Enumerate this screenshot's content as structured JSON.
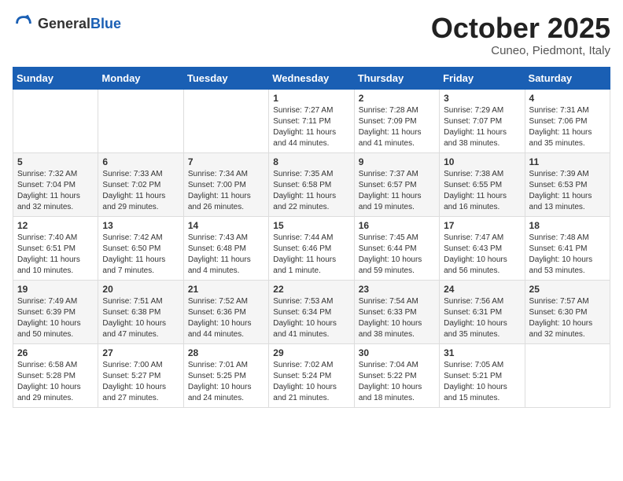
{
  "logo": {
    "general": "General",
    "blue": "Blue"
  },
  "title": {
    "month": "October 2025",
    "location": "Cuneo, Piedmont, Italy"
  },
  "weekdays": [
    "Sunday",
    "Monday",
    "Tuesday",
    "Wednesday",
    "Thursday",
    "Friday",
    "Saturday"
  ],
  "weeks": [
    [
      {
        "day": "",
        "info": ""
      },
      {
        "day": "",
        "info": ""
      },
      {
        "day": "",
        "info": ""
      },
      {
        "day": "1",
        "info": "Sunrise: 7:27 AM\nSunset: 7:11 PM\nDaylight: 11 hours\nand 44 minutes."
      },
      {
        "day": "2",
        "info": "Sunrise: 7:28 AM\nSunset: 7:09 PM\nDaylight: 11 hours\nand 41 minutes."
      },
      {
        "day": "3",
        "info": "Sunrise: 7:29 AM\nSunset: 7:07 PM\nDaylight: 11 hours\nand 38 minutes."
      },
      {
        "day": "4",
        "info": "Sunrise: 7:31 AM\nSunset: 7:06 PM\nDaylight: 11 hours\nand 35 minutes."
      }
    ],
    [
      {
        "day": "5",
        "info": "Sunrise: 7:32 AM\nSunset: 7:04 PM\nDaylight: 11 hours\nand 32 minutes."
      },
      {
        "day": "6",
        "info": "Sunrise: 7:33 AM\nSunset: 7:02 PM\nDaylight: 11 hours\nand 29 minutes."
      },
      {
        "day": "7",
        "info": "Sunrise: 7:34 AM\nSunset: 7:00 PM\nDaylight: 11 hours\nand 26 minutes."
      },
      {
        "day": "8",
        "info": "Sunrise: 7:35 AM\nSunset: 6:58 PM\nDaylight: 11 hours\nand 22 minutes."
      },
      {
        "day": "9",
        "info": "Sunrise: 7:37 AM\nSunset: 6:57 PM\nDaylight: 11 hours\nand 19 minutes."
      },
      {
        "day": "10",
        "info": "Sunrise: 7:38 AM\nSunset: 6:55 PM\nDaylight: 11 hours\nand 16 minutes."
      },
      {
        "day": "11",
        "info": "Sunrise: 7:39 AM\nSunset: 6:53 PM\nDaylight: 11 hours\nand 13 minutes."
      }
    ],
    [
      {
        "day": "12",
        "info": "Sunrise: 7:40 AM\nSunset: 6:51 PM\nDaylight: 11 hours\nand 10 minutes."
      },
      {
        "day": "13",
        "info": "Sunrise: 7:42 AM\nSunset: 6:50 PM\nDaylight: 11 hours\nand 7 minutes."
      },
      {
        "day": "14",
        "info": "Sunrise: 7:43 AM\nSunset: 6:48 PM\nDaylight: 11 hours\nand 4 minutes."
      },
      {
        "day": "15",
        "info": "Sunrise: 7:44 AM\nSunset: 6:46 PM\nDaylight: 11 hours\nand 1 minute."
      },
      {
        "day": "16",
        "info": "Sunrise: 7:45 AM\nSunset: 6:44 PM\nDaylight: 10 hours\nand 59 minutes."
      },
      {
        "day": "17",
        "info": "Sunrise: 7:47 AM\nSunset: 6:43 PM\nDaylight: 10 hours\nand 56 minutes."
      },
      {
        "day": "18",
        "info": "Sunrise: 7:48 AM\nSunset: 6:41 PM\nDaylight: 10 hours\nand 53 minutes."
      }
    ],
    [
      {
        "day": "19",
        "info": "Sunrise: 7:49 AM\nSunset: 6:39 PM\nDaylight: 10 hours\nand 50 minutes."
      },
      {
        "day": "20",
        "info": "Sunrise: 7:51 AM\nSunset: 6:38 PM\nDaylight: 10 hours\nand 47 minutes."
      },
      {
        "day": "21",
        "info": "Sunrise: 7:52 AM\nSunset: 6:36 PM\nDaylight: 10 hours\nand 44 minutes."
      },
      {
        "day": "22",
        "info": "Sunrise: 7:53 AM\nSunset: 6:34 PM\nDaylight: 10 hours\nand 41 minutes."
      },
      {
        "day": "23",
        "info": "Sunrise: 7:54 AM\nSunset: 6:33 PM\nDaylight: 10 hours\nand 38 minutes."
      },
      {
        "day": "24",
        "info": "Sunrise: 7:56 AM\nSunset: 6:31 PM\nDaylight: 10 hours\nand 35 minutes."
      },
      {
        "day": "25",
        "info": "Sunrise: 7:57 AM\nSunset: 6:30 PM\nDaylight: 10 hours\nand 32 minutes."
      }
    ],
    [
      {
        "day": "26",
        "info": "Sunrise: 6:58 AM\nSunset: 5:28 PM\nDaylight: 10 hours\nand 29 minutes."
      },
      {
        "day": "27",
        "info": "Sunrise: 7:00 AM\nSunset: 5:27 PM\nDaylight: 10 hours\nand 27 minutes."
      },
      {
        "day": "28",
        "info": "Sunrise: 7:01 AM\nSunset: 5:25 PM\nDaylight: 10 hours\nand 24 minutes."
      },
      {
        "day": "29",
        "info": "Sunrise: 7:02 AM\nSunset: 5:24 PM\nDaylight: 10 hours\nand 21 minutes."
      },
      {
        "day": "30",
        "info": "Sunrise: 7:04 AM\nSunset: 5:22 PM\nDaylight: 10 hours\nand 18 minutes."
      },
      {
        "day": "31",
        "info": "Sunrise: 7:05 AM\nSunset: 5:21 PM\nDaylight: 10 hours\nand 15 minutes."
      },
      {
        "day": "",
        "info": ""
      }
    ]
  ]
}
